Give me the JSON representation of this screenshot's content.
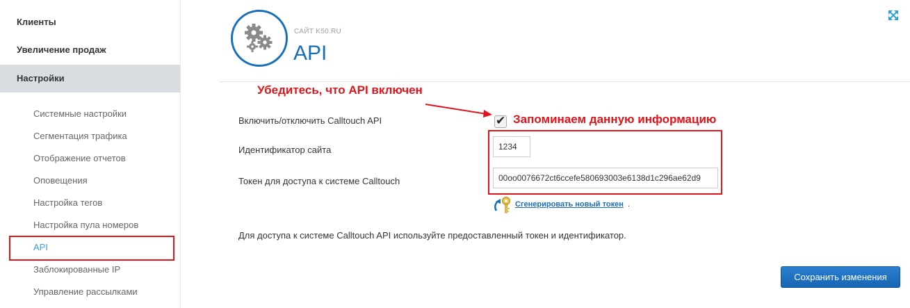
{
  "sidebar": {
    "main_items": [
      {
        "label": "Клиенты"
      },
      {
        "label": "Увеличение продаж"
      },
      {
        "label": "Настройки"
      }
    ],
    "sub_items": [
      {
        "label": "Системные настройки"
      },
      {
        "label": "Сегментация трафика"
      },
      {
        "label": "Отображение отчетов"
      },
      {
        "label": "Оповещения"
      },
      {
        "label": "Настройка тегов"
      },
      {
        "label": "Настройка пула номеров"
      },
      {
        "label": "API"
      },
      {
        "label": "Заблокированные IP"
      },
      {
        "label": "Управление рассылками"
      }
    ]
  },
  "header": {
    "site_label": "САЙТ K50.RU",
    "title": "API"
  },
  "annotations": {
    "api_enabled": "Убедитесь, что API включен",
    "remember_info": "Запоминаем данную информацию"
  },
  "form": {
    "enable_label": "Включить/отключить Calltouch API",
    "enable_checked": true,
    "site_id_label": "Идентификатор сайта",
    "site_id_value": "1234",
    "token_label": "Токен для доступа к системе Calltouch",
    "token_value": "00oo0076672ct6ccefe580693003e6138d1c296ae62d9",
    "generate_link": "Сгенерировать новый токен",
    "generate_suffix": "."
  },
  "info_text": "Для доступа к системе Calltouch API используйте предоставленный токен и идентификатор.",
  "save_button": "Сохранить изменения",
  "colors": {
    "accent": "#1a6db9",
    "annotation_red": "#e0141b",
    "sidebar_active_bg": "#d9dde1",
    "current_item": "#3d9bd6"
  },
  "icons": {
    "header": "gears-icon",
    "expand": "expand-arrows-icon",
    "generate": "key-refresh-icon",
    "checkbox": "checkmark-icon"
  }
}
